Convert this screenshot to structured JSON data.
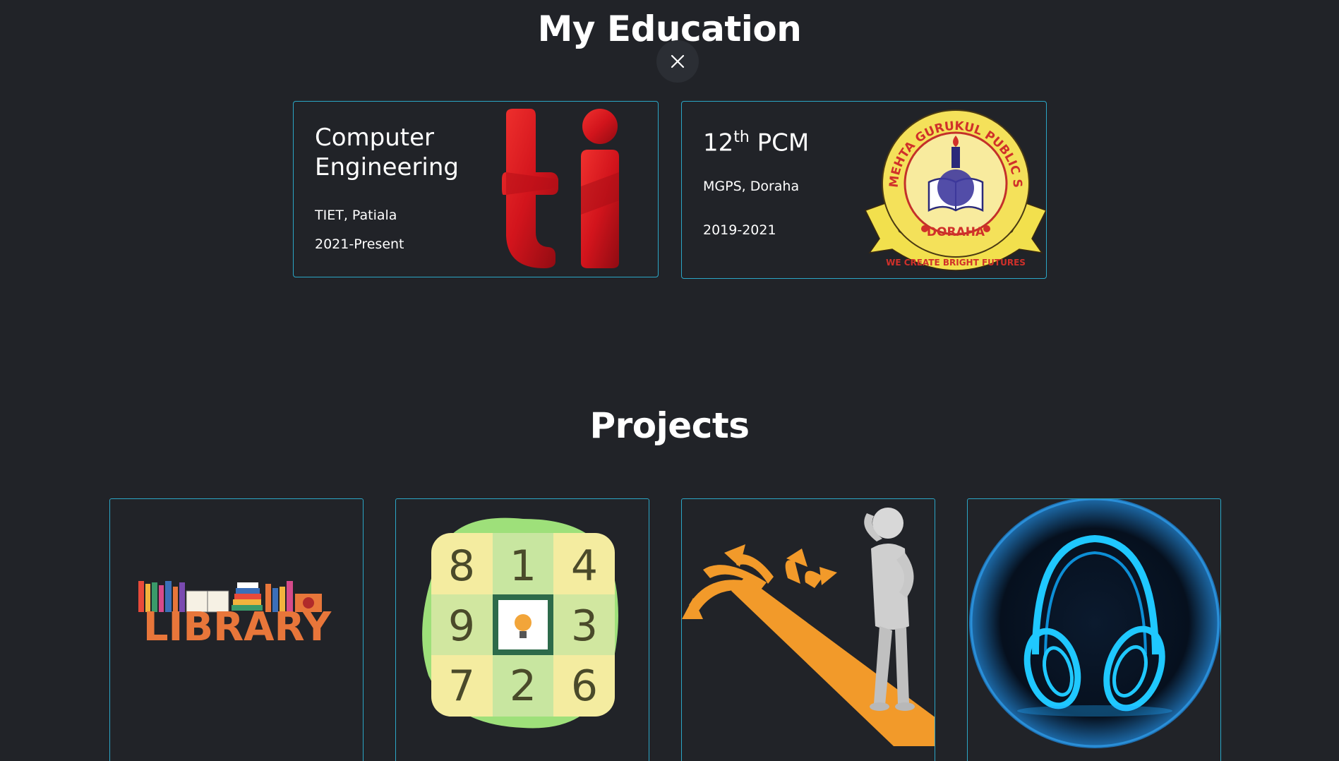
{
  "education": {
    "title": "My Education",
    "close_label": "×",
    "cards": [
      {
        "heading_line1": "Computer",
        "heading_line2": "Engineering",
        "institution": "TIET, Patiala",
        "years": "2021-Present",
        "logo": "ti-logo"
      },
      {
        "heading_base": "12",
        "heading_sup": "th",
        "heading_rest": " PCM",
        "institution": "MGPS, Doraha",
        "years": "2019-2021",
        "logo": "mehta-gurukul-school-emblem",
        "emblem_text_top": "MEHTA GURUKUL PUBLIC SEN. SEC. SCHOOL",
        "emblem_text_mid": "DORAHA",
        "emblem_text_bottom": "WE CREATE BRIGHT FUTURES"
      }
    ]
  },
  "projects": {
    "title": "Projects",
    "cards": [
      {
        "image": "library-books-illustration",
        "image_text": "LIBRARY"
      },
      {
        "image": "sudoku-puzzle-icon",
        "digits": [
          "8",
          "1",
          "4",
          "9",
          "",
          "3",
          "7",
          "2",
          "6"
        ]
      },
      {
        "image": "decision-crossroads-illustration"
      },
      {
        "image": "neon-headphones-icon"
      }
    ]
  },
  "colors": {
    "background": "#212328",
    "card_border": "#2ba6c6",
    "text": "#ffffff"
  }
}
